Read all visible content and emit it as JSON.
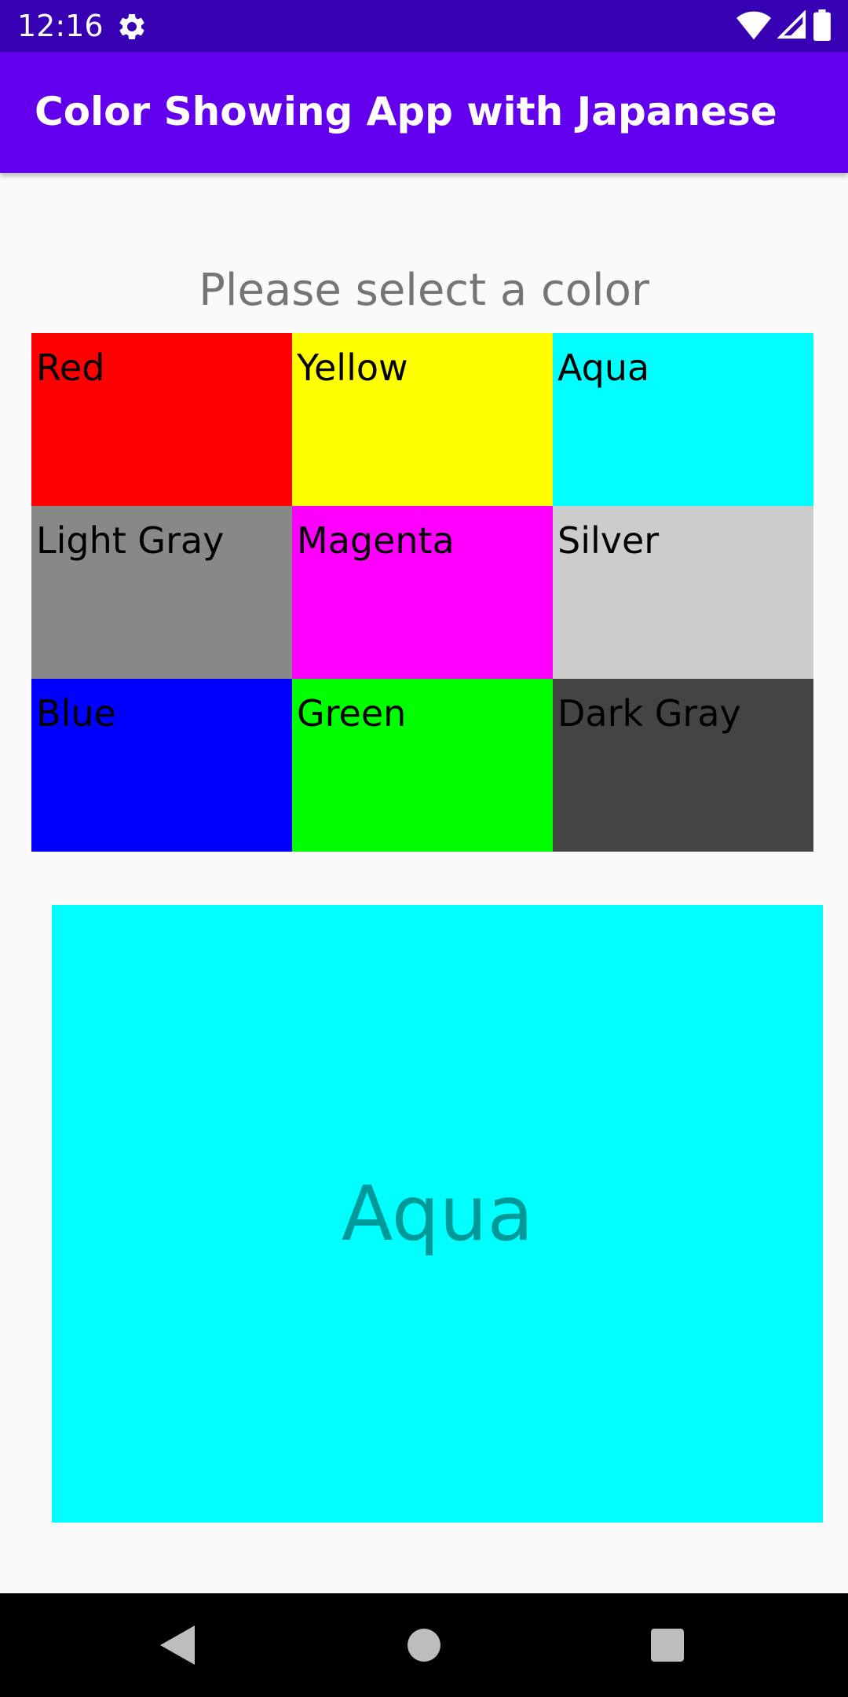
{
  "status_bar": {
    "time": "12:16",
    "icons": [
      "gear-icon",
      "wifi-icon",
      "signal-icon",
      "battery-icon"
    ]
  },
  "app_bar": {
    "title": "Color Showing App with Japanese",
    "color": "#6200ee"
  },
  "main": {
    "prompt": "Please select a color",
    "colors": [
      {
        "label": "Red",
        "color": "#ff0000"
      },
      {
        "label": "Yellow",
        "color": "#ffff00"
      },
      {
        "label": "Aqua",
        "color": "#00ffff"
      },
      {
        "label": "Light Gray",
        "color": "#888888"
      },
      {
        "label": "Magenta",
        "color": "#ff00ff"
      },
      {
        "label": "Silver",
        "color": "#cccccc"
      },
      {
        "label": "Blue",
        "color": "#0000ff"
      },
      {
        "label": "Green",
        "color": "#00ff00"
      },
      {
        "label": "Dark Gray",
        "color": "#444444"
      }
    ],
    "display": {
      "label": "Aqua",
      "color": "#00ffff",
      "text_color": "#009999"
    }
  },
  "nav_bar": {
    "icons": [
      "back-icon",
      "home-icon",
      "recents-icon"
    ]
  }
}
